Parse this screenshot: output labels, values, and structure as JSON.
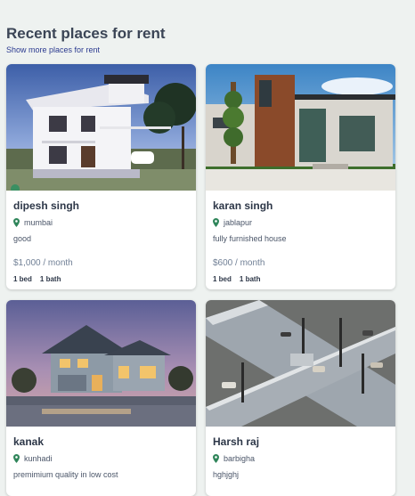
{
  "section": {
    "title": "Recent places for rent",
    "more_link": "Show more places for rent"
  },
  "listings": [
    {
      "name": "dipesh singh",
      "location": "mumbai",
      "description": "good",
      "price": "$1,000 / month",
      "beds": "1 bed",
      "baths": "1 bath",
      "image_alt": "modern white two-storey villa at dusk"
    },
    {
      "name": "karan singh",
      "location": "jablapur",
      "description": "fully furnished house",
      "price": "$600 / month",
      "beds": "1 bed",
      "baths": "1 bath",
      "image_alt": "contemporary house with wood and glass facade"
    },
    {
      "name": "kanak",
      "location": "kunhadi",
      "description": "premimium quality in low cost",
      "image_alt": "suburban house with lights on at twilight"
    },
    {
      "name": "Harsh raj",
      "location": "barbigha",
      "description": "hghjghj",
      "image_alt": "3d road intersection with traffic lights"
    }
  ],
  "colors": {
    "background": "#eef2f0",
    "pin": "#2f855a",
    "link": "#2b3a8f"
  },
  "icons": {
    "location": "map-pin-icon"
  }
}
